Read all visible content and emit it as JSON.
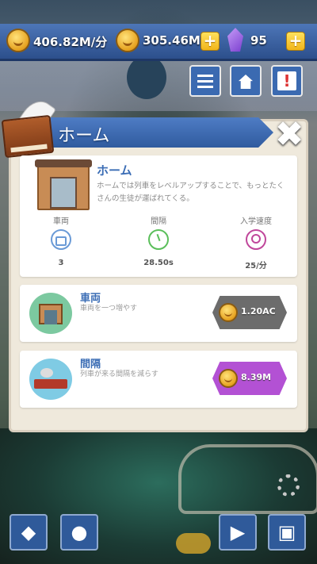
{
  "topbar": {
    "income_rate": "406.82M/分",
    "coins": "305.46M",
    "gems": "95",
    "plus_label": "+"
  },
  "dialog": {
    "title": "ホーム",
    "close_label": "✖",
    "info": {
      "title": "ホーム",
      "description": "ホームでは列車をレベルアップすることで、もっとたくさんの生徒が運ばれてくる。",
      "stats": [
        {
          "label": "車両",
          "value": "3",
          "icon": "train-car-icon"
        },
        {
          "label": "間隔",
          "value": "28.50s",
          "icon": "clock-icon"
        },
        {
          "label": "入学速度",
          "value": "25/分",
          "icon": "student-icon"
        }
      ]
    },
    "upgrades": [
      {
        "title": "車両",
        "description": "車両を一つ増やす",
        "price": "1.20AC",
        "icon": "station-gate-icon",
        "button_color": "#6c6c6c"
      },
      {
        "title": "間隔",
        "description": "列車が来る間隔を減らす",
        "price": "8.39M",
        "icon": "train-icon",
        "button_color": "#b351d4"
      }
    ]
  },
  "bottom_bar": {
    "buttons": [
      {
        "name": "shop-button",
        "icon": "diamond-cart-icon"
      },
      {
        "name": "piggy-bank-button",
        "icon": "piggy-bank-icon"
      },
      {
        "name": "video-button",
        "icon": "video-play-icon"
      },
      {
        "name": "cards-button",
        "icon": "cards-icon"
      }
    ]
  },
  "colors": {
    "topbar": "#3b65a8",
    "accent_blue": "#3b6db5",
    "coin": "#f1b51a",
    "panel": "#efe9dc"
  }
}
